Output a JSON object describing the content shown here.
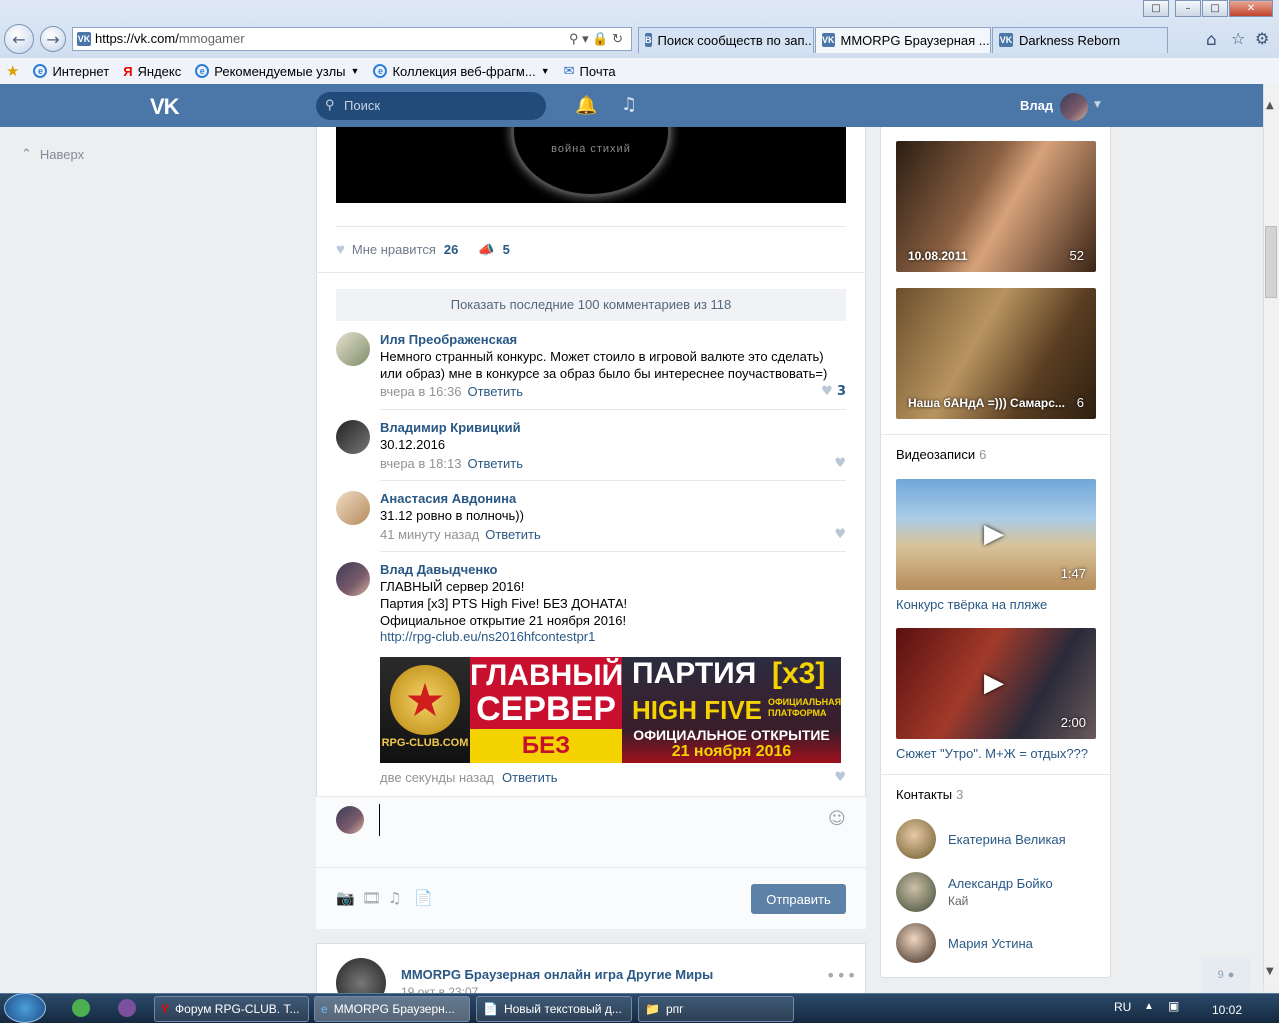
{
  "browser": {
    "url_domain": "https://vk.com/",
    "url_path": "mmogamer",
    "tabs": [
      {
        "label": "Поиск сообществ по зап...",
        "icon": "В"
      },
      {
        "label": "MMORPG Браузерная ...",
        "icon": "VK"
      },
      {
        "label": "Darkness Reborn",
        "icon": "VK"
      }
    ],
    "favorites": [
      "Интернет",
      "Яндекс",
      "Рекомендуемые узлы",
      "Коллекция веб-фрагм...",
      "Почта"
    ]
  },
  "header": {
    "search_placeholder": "Поиск",
    "user_name": "Влад"
  },
  "sidebar": {
    "up_label": "Наверх"
  },
  "post": {
    "video_text": "война стихий",
    "like_label": "Мне нравится",
    "like_count": "26",
    "share_count": "5",
    "show_comments": "Показать последние 100 комментариев из 118",
    "comments": [
      {
        "author": "Иля Преображенская",
        "text": "Немного странный конкурс. Может стоило в игровой валюте это сделать)\nили образ) мне в конкурсе за образ было бы интереснее поучаствовать=)",
        "time": "вчера в 16:36",
        "reply": "Ответить",
        "likes": "3"
      },
      {
        "author": "Владимир Кривицкий",
        "text": "30.12.2016",
        "time": "вчера в 18:13",
        "reply": "Ответить",
        "likes": ""
      },
      {
        "author": "Анастасия Авдонина",
        "text": "31.12 ровно в полночь))",
        "time": "41 минуту назад",
        "reply": "Ответить",
        "likes": ""
      },
      {
        "author": "Влад Давыдченко",
        "text": "ГЛАВНЫЙ сервер 2016!\nПартия [x3] PTS High Five! БЕЗ ДОНАТА!\nОфициальное открытие 21 ноября 2016!",
        "link": "http://rpg-club.eu/ns2016hfcontestpr1",
        "time": "две секунды назад",
        "reply": "Ответить",
        "likes": ""
      }
    ],
    "banner": {
      "logo_text": "RPG-CLUB.COM",
      "line1": "ГЛАВНЫЙ",
      "line2": "СЕРВЕР",
      "line3": "БЕЗ ДОНАТА",
      "party": "ПАРТИЯ",
      "x3": "[x3]",
      "hf": "HIGH FIVE",
      "platform": "ОФИЦИАЛЬНАЯ ПЛАТФОРМА",
      "opening": "ОФИЦИАЛЬНОЕ ОТКРЫТИЕ",
      "date": "21 ноября 2016"
    },
    "send_label": "Отправить"
  },
  "post2": {
    "title": "MMORPG Браузерная онлайн игра Другие Миры",
    "date": "19 окт в 23:07"
  },
  "right": {
    "photos": [
      {
        "caption": "10.08.2011",
        "count": "52"
      },
      {
        "caption": "Наша бАНдА =))) Самарс...",
        "count": "6"
      }
    ],
    "videos_title": "Видеозаписи",
    "videos_count": "6",
    "videos": [
      {
        "title": "Конкурс твёрка на пляже",
        "duration": "1:47"
      },
      {
        "title": "Сюжет \"Утро\". М+Ж = отдых???",
        "duration": "2:00"
      }
    ],
    "contacts_title": "Контакты",
    "contacts_count": "3",
    "contacts": [
      {
        "name": "Екатерина Великая",
        "sub": ""
      },
      {
        "name": "Александр Бойко",
        "sub": "Кай"
      },
      {
        "name": "Мария Устина",
        "sub": ""
      }
    ],
    "friends_count": "9"
  },
  "taskbar": {
    "items": [
      "Форум RPG-CLUB. Т...",
      "MMORPG Браузерн...",
      "Новый текстовый д...",
      "рпг"
    ],
    "lang": "RU",
    "clock": "10:02"
  }
}
